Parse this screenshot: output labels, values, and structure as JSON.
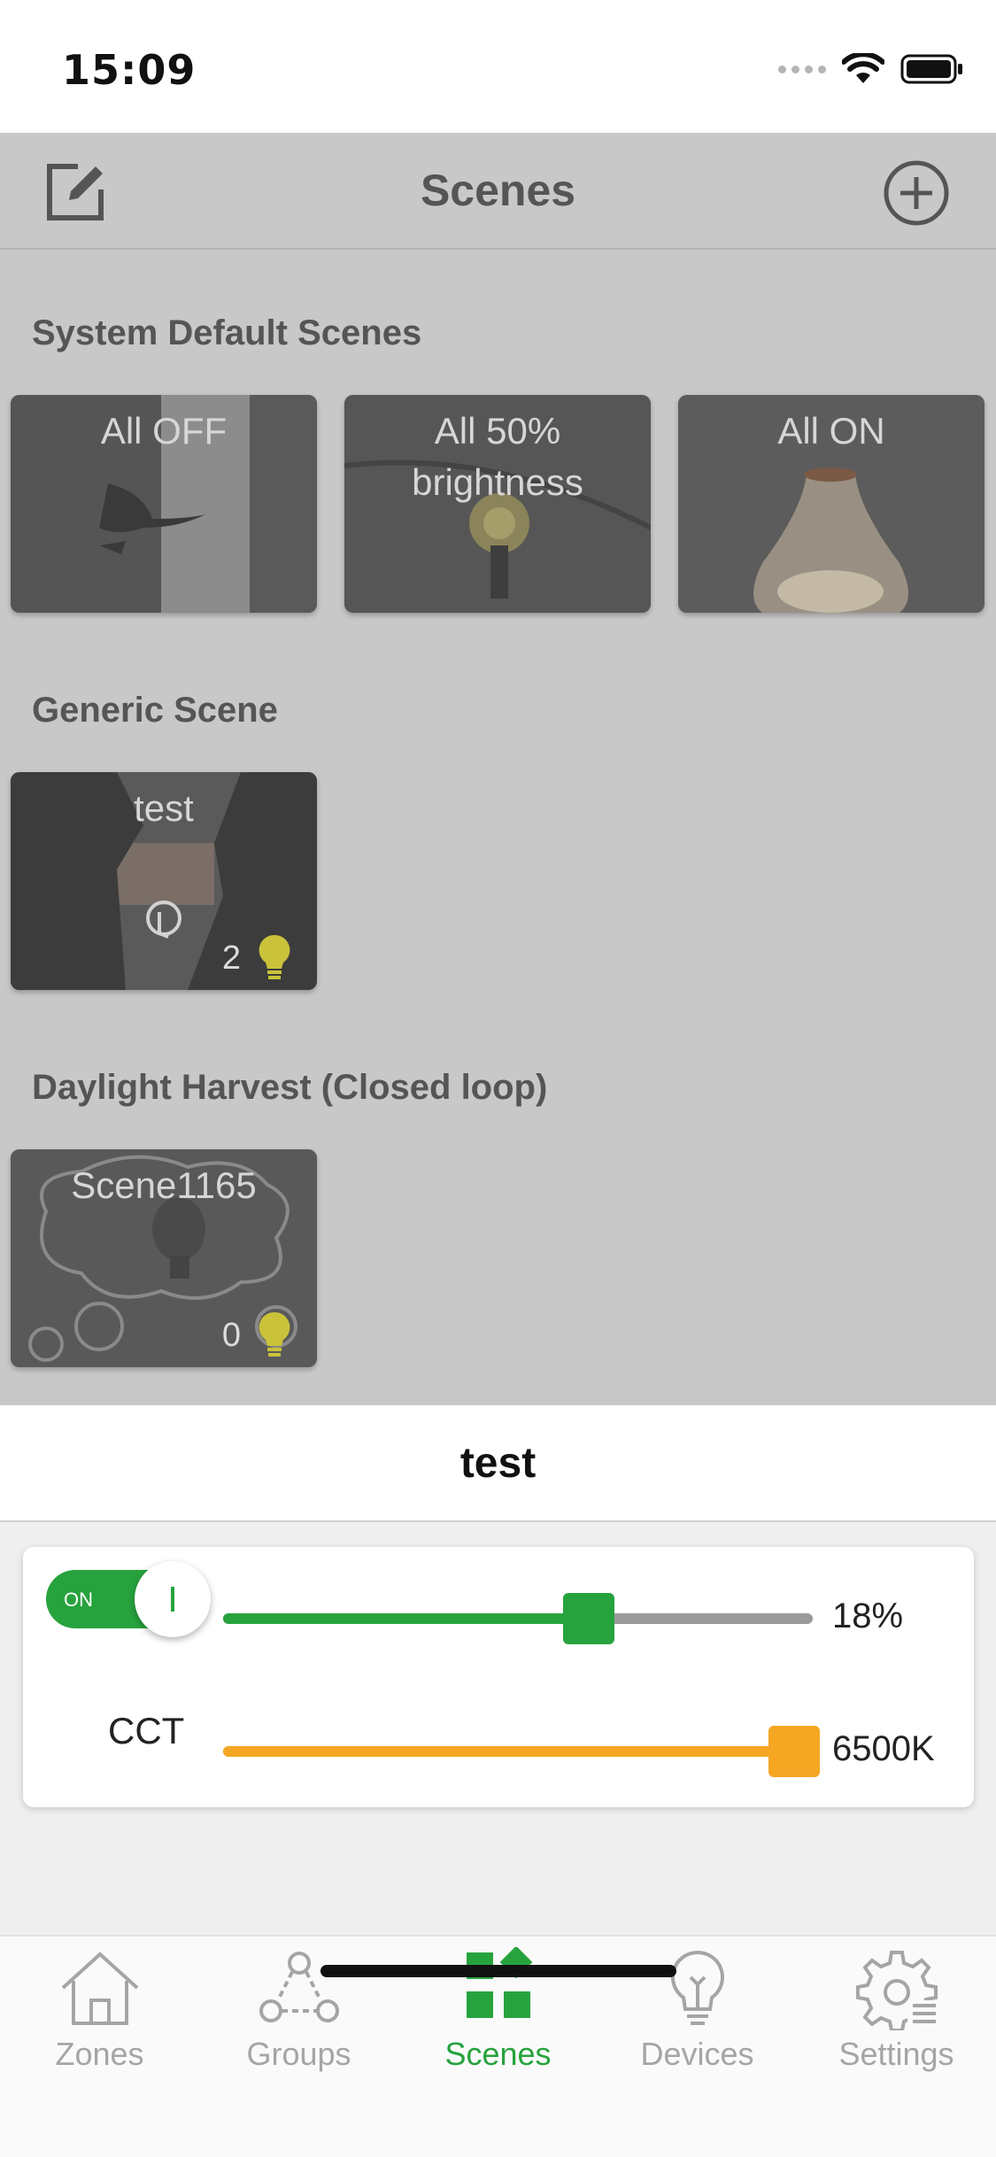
{
  "status_bar": {
    "time": "15:09"
  },
  "nav": {
    "title": "Scenes",
    "edit_icon": "edit-icon",
    "add_icon": "plus-circle-icon"
  },
  "sections": {
    "system": {
      "title": "System Default Scenes",
      "cards": [
        {
          "label": "All OFF"
        },
        {
          "label": "All 50% brightness"
        },
        {
          "label": "All ON"
        }
      ]
    },
    "generic": {
      "title": "Generic Scene",
      "cards": [
        {
          "label": "test",
          "count": "2"
        }
      ]
    },
    "daylight": {
      "title": "Daylight Harvest (Closed loop)",
      "cards": [
        {
          "label": "Scene1165",
          "count": "0"
        }
      ]
    }
  },
  "sheet": {
    "title": "test",
    "toggle": {
      "label": "ON",
      "state": "on"
    },
    "brightness": {
      "value_text": "18%",
      "slider_fraction": 0.62
    },
    "cct": {
      "label": "CCT",
      "value_text": "6500K",
      "slider_fraction": 1.0
    }
  },
  "tabs": [
    {
      "label": "Zones",
      "icon": "home-icon",
      "active": false
    },
    {
      "label": "Groups",
      "icon": "groups-icon",
      "active": false
    },
    {
      "label": "Scenes",
      "icon": "scenes-icon",
      "active": true
    },
    {
      "label": "Devices",
      "icon": "bulb-icon",
      "active": false
    },
    {
      "label": "Settings",
      "icon": "gear-icon",
      "active": false
    }
  ],
  "colors": {
    "accent_green": "#27a33d",
    "accent_orange": "#f5a623",
    "bulb_yellow": "#c9c23a",
    "inactive_gray": "#a5a5a5"
  }
}
